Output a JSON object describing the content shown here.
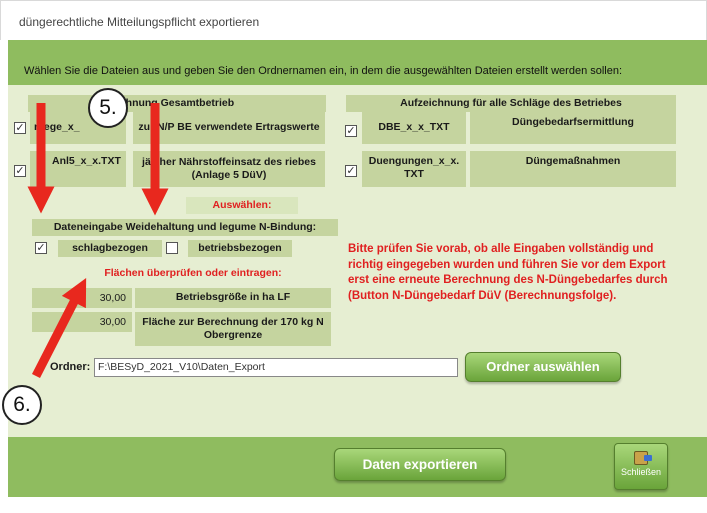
{
  "window": {
    "title": "düngerechtliche Mitteilungspflicht exportieren"
  },
  "instruction": "Wählen Sie die Dateien aus und geben Sie den Ordnernamen ein, in dem die ausgewählten Dateien erstellt werden sollen:",
  "left_section": {
    "header": "chnung Gesamtbetrieb",
    "rows": [
      {
        "file": "raege_x_",
        "checked": true,
        "desc": "zur N/P BE verwendete Ertragswerte"
      },
      {
        "file": "Anl5_x_x.TXT",
        "checked": true,
        "desc": "jä cher Nährstoffeinsatz des riebes (Anlage 5 DüV)"
      }
    ],
    "auswaehlen_label": "Auswählen:"
  },
  "right_section": {
    "header": "Aufzeichnung für alle Schläge des Betriebes",
    "rows": [
      {
        "file": "DBE_x_x_TXT",
        "checked": true,
        "desc": "Düngebedarfsermittlung"
      },
      {
        "file": "Duengungen_x_x.TXT",
        "checked": true,
        "desc": "Düngemaßnahmen"
      }
    ]
  },
  "weide": {
    "header": "Dateneingabe Weidehaltung und legume N-Bindung:",
    "options": [
      {
        "label": "schlagbezogen",
        "checked": true
      },
      {
        "label": "betriebsbezogen",
        "checked": false
      }
    ],
    "flaechen_label": "Flächen überprüfen oder eintragen:",
    "fields": [
      {
        "value": "30,00",
        "label": "Betriebsgröße in ha LF"
      },
      {
        "value": "30,00",
        "label": "Fläche zur Berechnung der 170 kg N Obergrenze"
      }
    ]
  },
  "warning": "Bitte prüfen Sie vorab, ob alle Eingaben vollständig und richtig eingegeben wurden und führen Sie vor dem Export erst eine erneute Berechnung des N-Düngebedarfes durch (Button N-Düngebedarf DüV (Berechnungsfolge).",
  "ordner": {
    "label": "Ordner:",
    "value": "F:\\BESyD_2021_V10\\Daten_Export",
    "button": "Ordner auswählen"
  },
  "footer": {
    "export_button": "Daten exportieren",
    "close_button": "Schließen"
  },
  "annotations": [
    {
      "label": "5."
    },
    {
      "label": "6."
    }
  ],
  "colors": {
    "bar_green": "#8fbc5f",
    "panel_bg": "#e6eed2",
    "cell_green": "#c5d49f",
    "warning_red": "#e02020",
    "arrow_red": "#e8281e"
  }
}
